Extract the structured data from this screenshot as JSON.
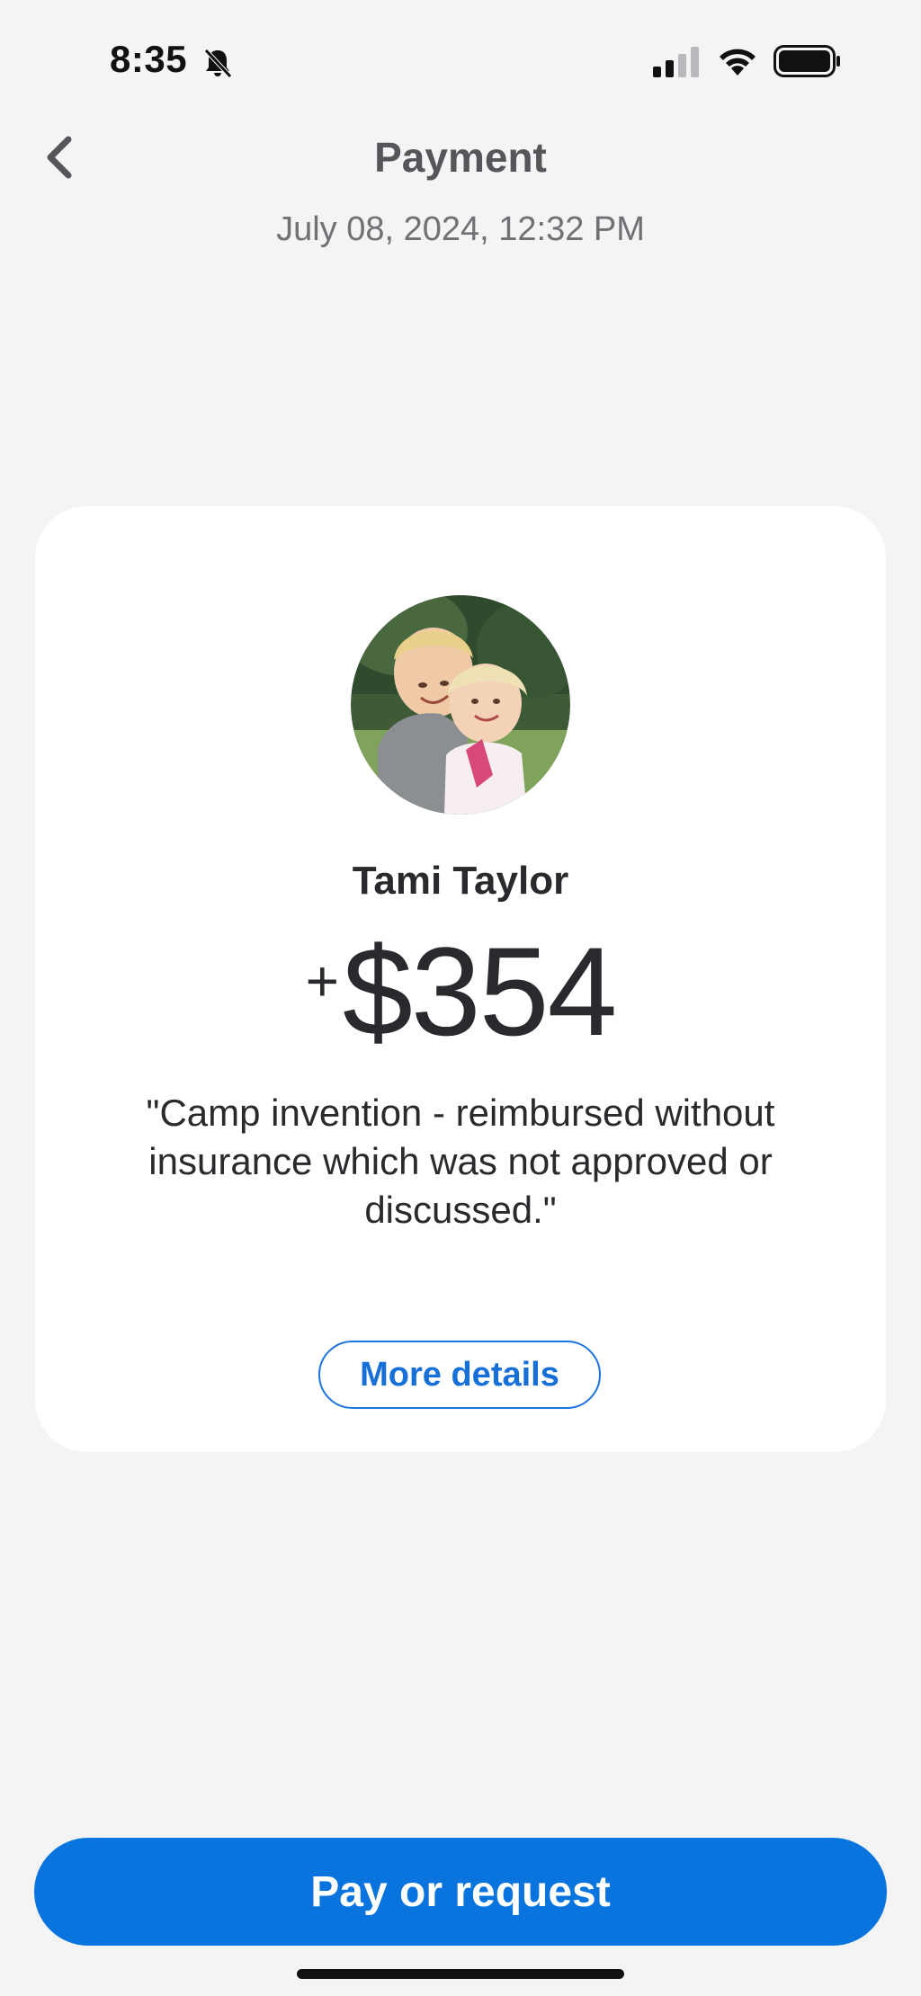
{
  "status_bar": {
    "time": "8:35",
    "icons": [
      "bell-slash-icon",
      "cellular-signal-icon",
      "wifi-icon",
      "battery-icon"
    ]
  },
  "header": {
    "back_icon": "chevron-left-icon",
    "title": "Payment",
    "date": "July 08, 2024, 12:32 PM"
  },
  "transaction": {
    "recipient_name": "Tami Taylor",
    "amount_sign": "+",
    "amount": "$354",
    "note": "\"Camp invention - reimbursed without insurance which was not approved or discussed.\"",
    "more_details_label": "More details"
  },
  "actions": {
    "pay_or_request_label": "Pay or request"
  },
  "colors": {
    "background": "#f4f4f5",
    "card": "#ffffff",
    "accent": "#0a74de",
    "text_primary": "#2a2a2e",
    "text_secondary": "#707075"
  }
}
